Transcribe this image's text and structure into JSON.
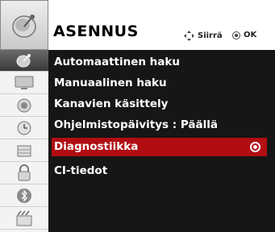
{
  "header": {
    "title": "ASENNUS",
    "move_hint": "Siirrä",
    "ok_hint": "OK"
  },
  "top_icon": "satellite-dish-icon",
  "sidebar": {
    "items": [
      {
        "icon": "satellite-dish-icon",
        "active": true
      },
      {
        "icon": "tv-screen-icon",
        "active": false
      },
      {
        "icon": "speaker-icon",
        "active": false
      },
      {
        "icon": "clock-icon",
        "active": false
      },
      {
        "icon": "lock-grid-icon",
        "active": false
      },
      {
        "icon": "padlock-icon",
        "active": false
      },
      {
        "icon": "bluetooth-icon",
        "active": false
      },
      {
        "icon": "media-icon",
        "active": false
      }
    ]
  },
  "menu": {
    "items": [
      {
        "label": "Automaattinen haku"
      },
      {
        "label": "Manuaalinen haku"
      },
      {
        "label": "Kanavien käsittely"
      },
      {
        "label": "Ohjelmistopäivitys : Päällä"
      },
      {
        "label": "Diagnostiikka",
        "selected": true
      },
      {
        "label": "CI-tiedot"
      }
    ]
  },
  "colors": {
    "panel_bg": "#161616",
    "selected_bg": "#b00e13",
    "text": "#ffffff"
  }
}
